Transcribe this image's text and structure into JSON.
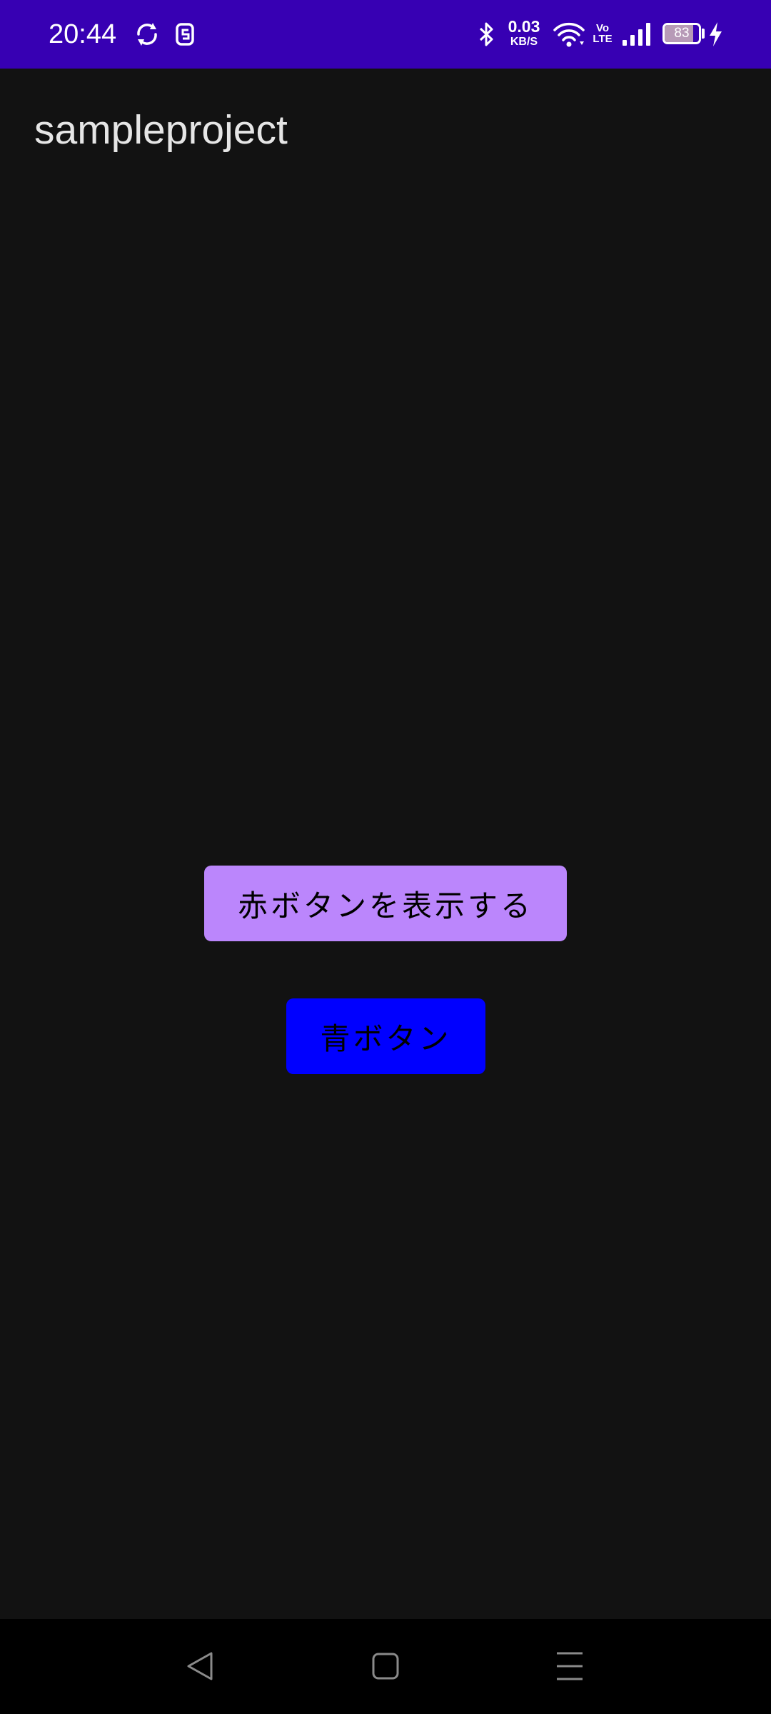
{
  "status_bar": {
    "time": "20:44",
    "left_icons": [
      "sync-icon",
      "notification-app-icon"
    ],
    "network_speed_value": "0.03",
    "network_speed_unit": "KB/S",
    "volte_line1": "Vo",
    "volte_line2": "LTE",
    "battery_level": "83",
    "battery_fraction": 0.83,
    "right_icons": [
      "bluetooth-icon",
      "wifi-icon",
      "cellular-signal-icon",
      "charging-bolt-icon"
    ],
    "background_color": "#3700b3"
  },
  "app_bar": {
    "title": "sampleproject"
  },
  "main": {
    "show_red_button_label": "赤ボタンを表示する",
    "show_red_button_color": "#bb86fc",
    "blue_button_label": "青ボタン",
    "blue_button_color": "#0000ff"
  },
  "nav_bar": {
    "buttons": [
      "back-icon",
      "home-icon",
      "recents-icon"
    ]
  }
}
